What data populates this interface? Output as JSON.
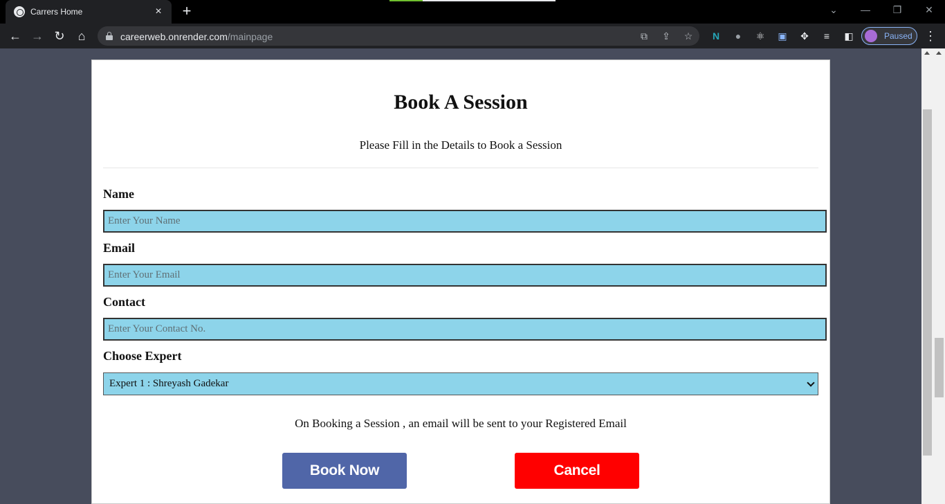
{
  "browser": {
    "tab_title": "Carrers Home",
    "tab_close": "×",
    "new_tab": "+",
    "window_controls": {
      "minimize": "—",
      "restore": "❐",
      "close": "✕",
      "tab_search": "⌄"
    },
    "nav": {
      "back": "←",
      "forward": "→",
      "reload": "↻",
      "home": "⌂"
    },
    "url_host": "careerweb.onrender.com",
    "url_path": "/mainpage",
    "omnibox_icons": [
      "translate-icon",
      "share-icon",
      "star-icon"
    ],
    "extensions": [
      "n-extension-icon",
      "mouse-extension-icon",
      "react-devtools-icon",
      "screen-capture-icon",
      "puzzle-icon",
      "media-control-icon",
      "side-panel-icon"
    ],
    "profile_label": "Paused",
    "menu": "⋮"
  },
  "form": {
    "title": "Book A Session",
    "subtitle": "Please Fill in the Details to Book a Session",
    "name_label": "Name",
    "name_placeholder": "Enter Your Name",
    "email_label": "Email",
    "email_placeholder": "Enter Your Email",
    "contact_label": "Contact",
    "contact_placeholder": "Enter Your Contact No.",
    "expert_label": "Choose Expert",
    "expert_selected": "Expert 1 : Shreyash Gadekar",
    "notice": "On Booking a Session , an email will be sent to your Registered Email",
    "book_label": "Book Now",
    "cancel_label": "Cancel"
  },
  "colors": {
    "input_bg": "#8dd4ea",
    "book_button": "#5066a8",
    "cancel_button": "#ff0000",
    "page_bg": "#474c5c"
  }
}
